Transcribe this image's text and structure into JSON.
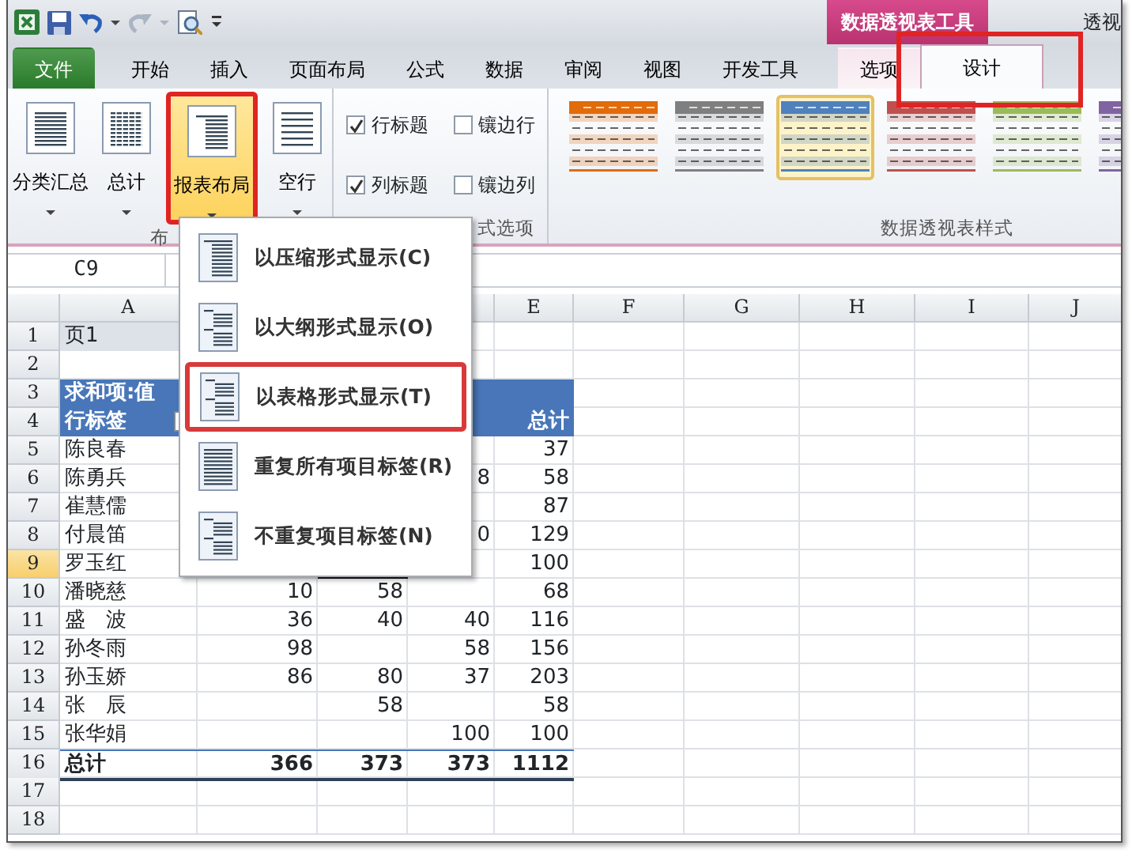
{
  "context_tab_group": {
    "title": "数据透视表工具"
  },
  "window_title": "透视",
  "tabs": [
    {
      "label": "文件",
      "kind": "file",
      "selected": false,
      "annotated": false
    },
    {
      "label": "开始",
      "kind": "normal",
      "selected": false,
      "annotated": false
    },
    {
      "label": "插入",
      "kind": "normal",
      "selected": false,
      "annotated": false
    },
    {
      "label": "页面布局",
      "kind": "normal",
      "selected": false,
      "annotated": false
    },
    {
      "label": "公式",
      "kind": "normal",
      "selected": false,
      "annotated": false
    },
    {
      "label": "数据",
      "kind": "normal",
      "selected": false,
      "annotated": false
    },
    {
      "label": "审阅",
      "kind": "normal",
      "selected": false,
      "annotated": false
    },
    {
      "label": "视图",
      "kind": "normal",
      "selected": false,
      "annotated": false
    },
    {
      "label": "开发工具",
      "kind": "normal",
      "selected": false,
      "annotated": false
    },
    {
      "label": "选项",
      "kind": "context",
      "selected": false,
      "annotated": false
    },
    {
      "label": "设计",
      "kind": "context",
      "selected": true,
      "annotated": true
    }
  ],
  "layout_group": {
    "label": "布",
    "buttons": [
      {
        "label": "分类汇总",
        "kind": "subtotals",
        "selected": false,
        "annotated": false
      },
      {
        "label": "总计",
        "kind": "totals",
        "selected": false,
        "annotated": false
      },
      {
        "label": "报表布局",
        "kind": "layout",
        "selected": true,
        "annotated": true
      },
      {
        "label": "空行",
        "kind": "blank",
        "selected": false,
        "annotated": false
      }
    ]
  },
  "options_group": {
    "label": "式选项",
    "checkboxes": [
      {
        "label": "行标题",
        "checked": true
      },
      {
        "label": "镶边行",
        "checked": false
      },
      {
        "label": "列标题",
        "checked": true
      },
      {
        "label": "镶边列",
        "checked": false
      }
    ]
  },
  "styles_group": {
    "label": "数据透视表样式",
    "styles": [
      {
        "color": "#e26b0a",
        "selected": false
      },
      {
        "color": "#7f7f7f",
        "selected": false
      },
      {
        "color": "#4f81bd",
        "selected": true
      },
      {
        "color": "#c0504d",
        "selected": false
      },
      {
        "color": "#9bbb59",
        "selected": false
      },
      {
        "color": "#8064a2",
        "selected": false
      }
    ]
  },
  "name_box": "C9",
  "columns": [
    "A",
    "E",
    "F",
    "G",
    "H",
    "I",
    "J"
  ],
  "rows": [
    {
      "header": "1",
      "kind": "filter",
      "selected": false,
      "cells": [
        "页1",
        "",
        "",
        "",
        ""
      ]
    },
    {
      "header": "2",
      "kind": "blank",
      "selected": false,
      "cells": [
        "",
        "",
        "",
        "",
        ""
      ]
    },
    {
      "header": "3",
      "kind": "header",
      "selected": false,
      "cells": [
        "求和项:值",
        "",
        "",
        "",
        ""
      ]
    },
    {
      "header": "4",
      "kind": "header",
      "selected": false,
      "cells": [
        "行标签",
        "",
        "",
        "",
        "总计"
      ]
    },
    {
      "header": "5",
      "kind": "data",
      "selected": false,
      "cells": [
        "陈良春",
        "",
        "",
        "",
        "37"
      ]
    },
    {
      "header": "6",
      "kind": "data",
      "selected": false,
      "cells": [
        "陈勇兵",
        "",
        "",
        "8",
        "58"
      ]
    },
    {
      "header": "7",
      "kind": "data",
      "selected": false,
      "cells": [
        "崔慧儒",
        "",
        "",
        "",
        "87"
      ]
    },
    {
      "header": "8",
      "kind": "data",
      "selected": false,
      "cells": [
        "付晨笛",
        "",
        "",
        "0",
        "129"
      ]
    },
    {
      "header": "9",
      "kind": "data",
      "selected": true,
      "cells": [
        "罗玉红",
        "",
        "",
        "",
        "100"
      ]
    },
    {
      "header": "10",
      "kind": "data",
      "selected": false,
      "cells": [
        "潘晓慈",
        "10",
        "58",
        "",
        "68"
      ]
    },
    {
      "header": "11",
      "kind": "data",
      "selected": false,
      "cells": [
        "盛　波",
        "36",
        "40",
        "40",
        "116"
      ]
    },
    {
      "header": "12",
      "kind": "data",
      "selected": false,
      "cells": [
        "孙冬雨",
        "98",
        "",
        "58",
        "156"
      ]
    },
    {
      "header": "13",
      "kind": "data",
      "selected": false,
      "cells": [
        "孙玉娇",
        "86",
        "80",
        "37",
        "203"
      ]
    },
    {
      "header": "14",
      "kind": "data",
      "selected": false,
      "cells": [
        "张　辰",
        "",
        "58",
        "",
        "58"
      ]
    },
    {
      "header": "15",
      "kind": "data",
      "selected": false,
      "cells": [
        "张华娟",
        "",
        "",
        "100",
        "100"
      ]
    },
    {
      "header": "16",
      "kind": "total",
      "selected": false,
      "cells": [
        "总计",
        "366",
        "373",
        "373",
        "1112"
      ]
    },
    {
      "header": "17",
      "kind": "blank",
      "selected": false,
      "cells": [
        "",
        "",
        "",
        "",
        ""
      ]
    },
    {
      "header": "18",
      "kind": "blank",
      "selected": false,
      "cells": [
        "",
        "",
        "",
        "",
        ""
      ]
    }
  ],
  "menu": {
    "items": [
      {
        "label": "以压缩形式显示(C)",
        "kind": "compact",
        "annotated": false
      },
      {
        "label": "以大纲形式显示(O)",
        "kind": "outline",
        "annotated": false
      },
      {
        "label": "以表格形式显示(T)",
        "kind": "tabular",
        "annotated": true
      },
      {
        "label": "重复所有项目标签(R)",
        "kind": "repeat",
        "annotated": false
      },
      {
        "label": "不重复项目标签(N)",
        "kind": "norepeat",
        "annotated": false
      }
    ]
  }
}
